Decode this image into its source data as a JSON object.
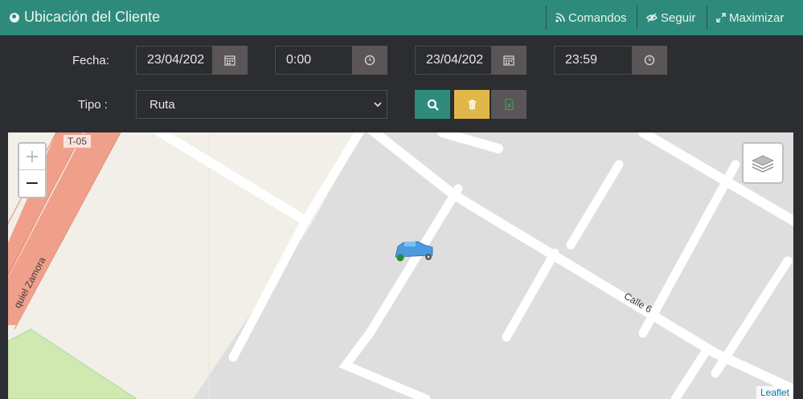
{
  "header": {
    "title": "Ubicación del Cliente",
    "actions": [
      {
        "label": "Comandos",
        "icon": "rss-icon"
      },
      {
        "label": "Seguir",
        "icon": "eye-icon"
      },
      {
        "label": "Maximizar",
        "icon": "expand-icon"
      }
    ]
  },
  "filters": {
    "fecha_label": "Fecha:",
    "date_from": "23/04/202",
    "time_from": "0:00",
    "date_to": "23/04/202",
    "time_to": "23:59",
    "tipo_label": "Tipo :",
    "tipo_value": "Ruta"
  },
  "map": {
    "zoom_in": "+",
    "zoom_out": "−",
    "road_badge": "T-05",
    "street_label_1": "Calle 6",
    "street_label_2": "quiel Zamora",
    "attribution": "Leaflet"
  },
  "colors": {
    "header": "#2e8b7b",
    "search_button": "#2e8b7b",
    "delete_button": "#e0b84a",
    "export_button": "#5a5556"
  }
}
